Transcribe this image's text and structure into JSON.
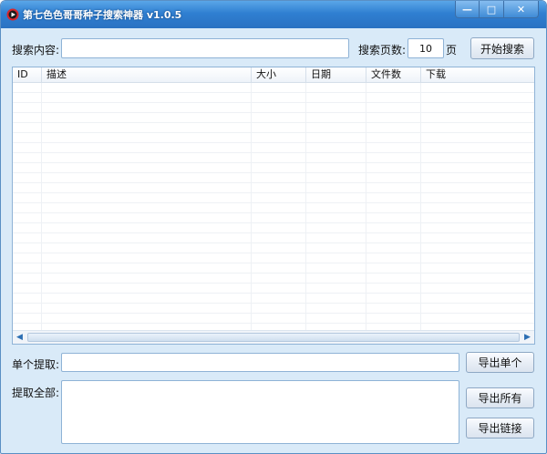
{
  "window": {
    "title": "第七色色哥哥种子搜索神器 v1.0.5",
    "minimize_label": "—",
    "maximize_label": "□",
    "close_label": "✕"
  },
  "search": {
    "content_label": "搜索内容:",
    "content_value": "",
    "pages_label": "搜索页数:",
    "pages_value": "10",
    "pages_unit": "页",
    "start_button": "开始搜索"
  },
  "results": {
    "columns": [
      "ID",
      "描述",
      "大小",
      "日期",
      "文件数",
      "下载"
    ],
    "rows": []
  },
  "extract": {
    "single_label": "单个提取:",
    "single_value": "",
    "export_single_button": "导出单个",
    "all_label": "提取全部:",
    "all_value": "",
    "export_all_button": "导出所有",
    "export_links_button": "导出链接"
  },
  "icons": {
    "app": "app-logo-icon",
    "scroll_left": "chevron-left-icon",
    "scroll_right": "chevron-right-icon"
  },
  "colors": {
    "titlebar": "#2f7fd1",
    "window_bg": "#d9eaf8",
    "app_icon_red": "#d8262b"
  }
}
